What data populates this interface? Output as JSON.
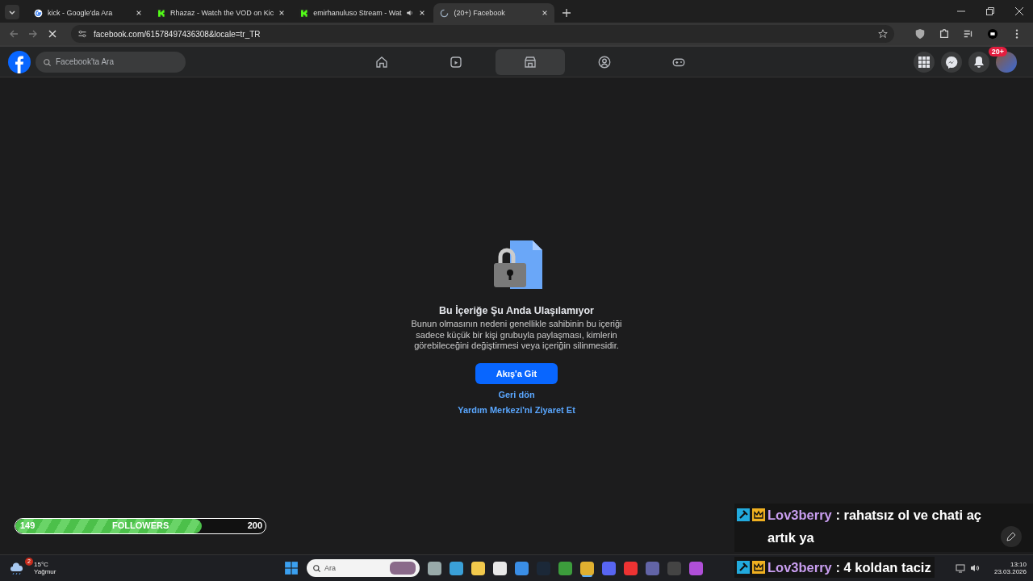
{
  "browser": {
    "tabs": [
      {
        "title": "kick - Google'da Ara",
        "kind": "google",
        "selected": false,
        "audio": false
      },
      {
        "title": "Rhazaz - Watch the VOD on Kic",
        "kind": "kick",
        "selected": false,
        "audio": false
      },
      {
        "title": "emirhanuluso Stream - Wat",
        "kind": "kick",
        "selected": false,
        "audio": true
      },
      {
        "title": "(20+) Facebook",
        "kind": "loading",
        "selected": true,
        "audio": false
      }
    ],
    "url": "facebook.com/61578497436308&locale=tr_TR"
  },
  "facebook": {
    "search_placeholder": "Facebook'ta Ara",
    "nav": [
      {
        "kind": "home",
        "selected": false
      },
      {
        "kind": "video",
        "selected": false
      },
      {
        "kind": "marketplace",
        "selected": true
      },
      {
        "kind": "groups",
        "selected": false
      },
      {
        "kind": "gaming",
        "selected": false
      }
    ],
    "notification_badge": "20+"
  },
  "content": {
    "title": "Bu İçeriğe Şu Anda Ulaşılamıyor",
    "message": "Bunun olmasının nedeni genellikle sahibinin bu içeriği sadece küçük bir kişi grubuyla paylaşması, kimlerin görebileceğini değiştirmesi veya içeriğin silinmesidir.",
    "primary_button": "Akış'a Git",
    "links": [
      "Geri dön",
      "Yardım Merkezi'ni Ziyaret Et"
    ]
  },
  "followers": {
    "current": "149",
    "label": "FOLLOWERS",
    "goal": "200",
    "level": 0.745
  },
  "chat": [
    {
      "user": "Lov3berry",
      "text": ": rahatsız ol ve chati aç artık ya"
    },
    {
      "user": "Lov3berry",
      "text": ": 4 koldan taciz"
    }
  ],
  "taskbar": {
    "temperature": "15°C",
    "condition": "Yağmur",
    "weather_badge": "2",
    "search_placeholder": "Ara",
    "time": "13:10",
    "date": "23.03.2026"
  }
}
